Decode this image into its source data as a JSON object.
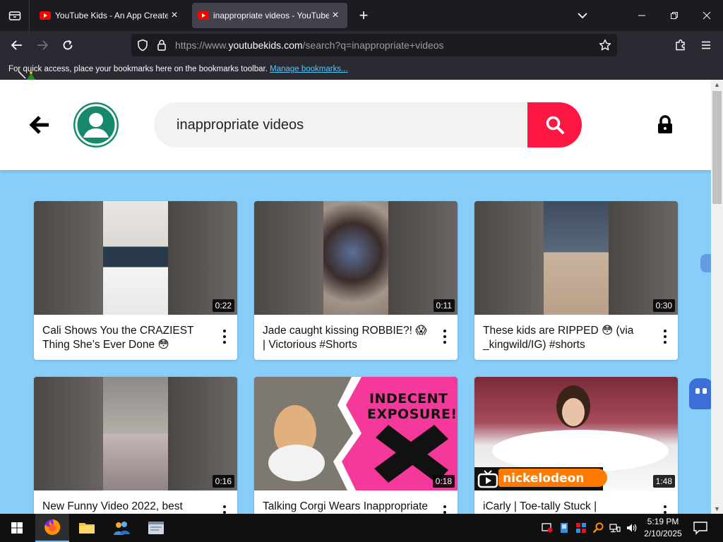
{
  "browser": {
    "tabs": [
      {
        "title": "YouTube Kids - An App Created",
        "active": false
      },
      {
        "title": "inappropriate videos - YouTube",
        "active": true
      }
    ],
    "url_prefix": "https://www.",
    "url_domain": "youtubekids.com",
    "url_rest": "/search?q=inappropriate+videos",
    "bookmarks_message": "For quick access, place your bookmarks here on the bookmarks toolbar.",
    "bookmarks_link": "Manage bookmarks..."
  },
  "page": {
    "search_query": "inappropriate videos",
    "colors": {
      "accent": "#ff1744",
      "avatar": "#16896c",
      "background": "#87cefa"
    },
    "videos": [
      {
        "title": "Cali Shows You the CRAZIEST Thing She’s Ever Done 😳",
        "duration": "0:22"
      },
      {
        "title": "Jade caught kissing ROBBIE?! 😱 | Victorious #Shorts",
        "duration": "0:11"
      },
      {
        "title": "These kids are RIPPED 😳 (via _kingwild/IG) #shorts",
        "duration": "0:30"
      },
      {
        "title": "New Funny Video 2022, best",
        "duration": "0:16"
      },
      {
        "title": "Talking Corgi Wears Inappropriate",
        "duration": "0:18"
      },
      {
        "title": "iCarly | Toe-tally Stuck |",
        "duration": "1:48"
      }
    ],
    "thumb_text": {
      "indecent": "INDECENT",
      "exposure": "EXPOSURE!",
      "nick": "nickelodeon"
    }
  },
  "taskbar": {
    "time": "5:19 PM",
    "date": "2/10/2025"
  }
}
